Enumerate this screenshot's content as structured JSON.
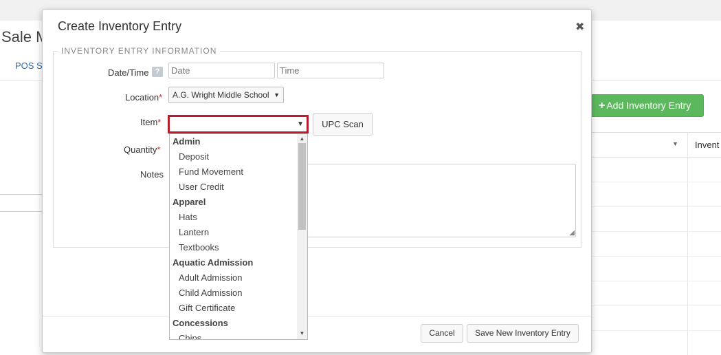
{
  "background": {
    "page_title": "Sale M",
    "tab": "POS Se",
    "add_button": "Add Inventory Entry",
    "column_header": "Invent"
  },
  "modal": {
    "title": "Create Inventory Entry",
    "section_legend": "INVENTORY ENTRY INFORMATION",
    "fields": {
      "datetime_label": "Date/Time",
      "help": "?",
      "date_placeholder": "Date",
      "time_placeholder": "Time",
      "location_label": "Location",
      "location_value": "A.G. Wright Middle School",
      "item_label": "Item",
      "item_value": "",
      "upc_button": "UPC Scan",
      "quantity_label": "Quantity",
      "notes_label": "Notes",
      "required_mark": "*"
    },
    "footer": {
      "cancel": "Cancel",
      "save": "Save New Inventory Entry"
    }
  },
  "item_dropdown": {
    "groups": [
      {
        "label": "Admin",
        "options": [
          "Deposit",
          "Fund Movement",
          "User Credit"
        ]
      },
      {
        "label": "Apparel",
        "options": [
          "Hats",
          "Lantern",
          "Textbooks"
        ]
      },
      {
        "label": "Aquatic Admission",
        "options": [
          "Adult Admission",
          "Child Admission",
          "Gift Certificate"
        ]
      },
      {
        "label": "Concessions",
        "options": [
          "Chips"
        ]
      }
    ]
  }
}
